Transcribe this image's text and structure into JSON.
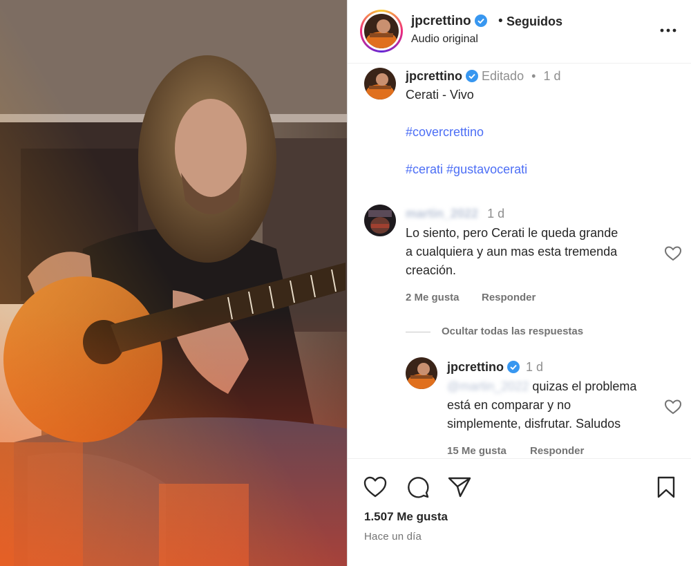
{
  "header": {
    "username": "jpcrettino",
    "separator": "•",
    "follow_status": "Seguidos",
    "subtitle": "Audio original",
    "more_icon": "more-horizontal-icon"
  },
  "caption": {
    "username": "jpcrettino",
    "edited": "Editado",
    "separator": "•",
    "age": "1 d",
    "line1": "Cerati - Vivo",
    "hashtag1": "#covercrettino",
    "hashtag2": "#cerati",
    "hashtag3": "#gustavocerati"
  },
  "comment1": {
    "username_blurred": "martin_2022",
    "age": "1 d",
    "line1": "Lo siento, pero Cerati le queda grande",
    "line2": "a cualquiera y aun mas esta tremenda",
    "line3": "creación.",
    "likes": "2 Me gusta",
    "reply": "Responder",
    "hide_replies": "Ocultar todas las respuestas"
  },
  "reply1": {
    "username": "jpcrettino",
    "age": "1 d",
    "mention_blurred": "@martin_2022",
    "line1_rest": " quizas el problema",
    "line2": "está en comparar y no",
    "line3": "simplemente, disfrutar. Saludos",
    "likes": "15 Me gusta",
    "reply": "Responder"
  },
  "actions": {
    "like_icon": "heart-icon",
    "comment_icon": "comment-icon",
    "share_icon": "paper-plane-icon",
    "save_icon": "bookmark-icon",
    "likes_count": "1.507 Me gusta",
    "timestamp": "Hace un día"
  },
  "colors": {
    "verified": "#3897f0",
    "link": "#4c6ef5",
    "muted": "#737373"
  }
}
